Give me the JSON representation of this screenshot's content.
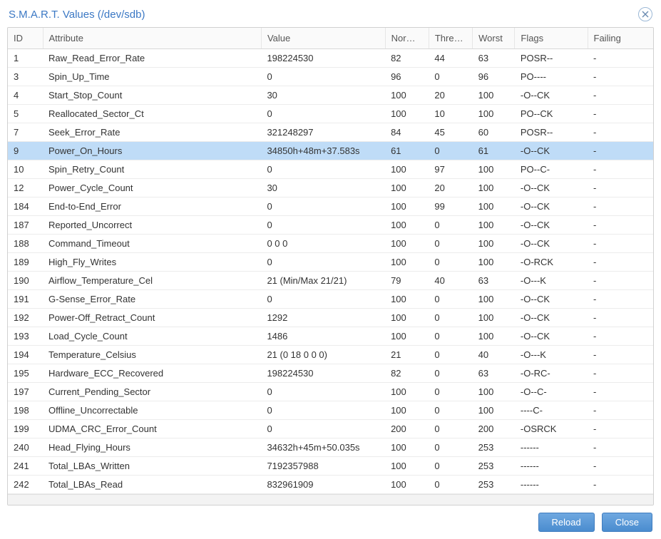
{
  "window": {
    "title": "S.M.A.R.T. Values (/dev/sdb)"
  },
  "buttons": {
    "reload": "Reload",
    "close": "Close"
  },
  "columns": {
    "id": "ID",
    "attribute": "Attribute",
    "value": "Value",
    "normalized": "Nor…",
    "threshold": "Thre…",
    "worst": "Worst",
    "flags": "Flags",
    "failing": "Failing"
  },
  "selected_row_index": 5,
  "rows": [
    {
      "id": "1",
      "attribute": "Raw_Read_Error_Rate",
      "value": "198224530",
      "nor": "82",
      "thr": "44",
      "worst": "63",
      "flags": "POSR--",
      "failing": "-"
    },
    {
      "id": "3",
      "attribute": "Spin_Up_Time",
      "value": "0",
      "nor": "96",
      "thr": "0",
      "worst": "96",
      "flags": "PO----",
      "failing": "-"
    },
    {
      "id": "4",
      "attribute": "Start_Stop_Count",
      "value": "30",
      "nor": "100",
      "thr": "20",
      "worst": "100",
      "flags": "-O--CK",
      "failing": "-"
    },
    {
      "id": "5",
      "attribute": "Reallocated_Sector_Ct",
      "value": "0",
      "nor": "100",
      "thr": "10",
      "worst": "100",
      "flags": "PO--CK",
      "failing": "-"
    },
    {
      "id": "7",
      "attribute": "Seek_Error_Rate",
      "value": "321248297",
      "nor": "84",
      "thr": "45",
      "worst": "60",
      "flags": "POSR--",
      "failing": "-"
    },
    {
      "id": "9",
      "attribute": "Power_On_Hours",
      "value": "34850h+48m+37.583s",
      "nor": "61",
      "thr": "0",
      "worst": "61",
      "flags": "-O--CK",
      "failing": "-"
    },
    {
      "id": "10",
      "attribute": "Spin_Retry_Count",
      "value": "0",
      "nor": "100",
      "thr": "97",
      "worst": "100",
      "flags": "PO--C-",
      "failing": "-"
    },
    {
      "id": "12",
      "attribute": "Power_Cycle_Count",
      "value": "30",
      "nor": "100",
      "thr": "20",
      "worst": "100",
      "flags": "-O--CK",
      "failing": "-"
    },
    {
      "id": "184",
      "attribute": "End-to-End_Error",
      "value": "0",
      "nor": "100",
      "thr": "99",
      "worst": "100",
      "flags": "-O--CK",
      "failing": "-"
    },
    {
      "id": "187",
      "attribute": "Reported_Uncorrect",
      "value": "0",
      "nor": "100",
      "thr": "0",
      "worst": "100",
      "flags": "-O--CK",
      "failing": "-"
    },
    {
      "id": "188",
      "attribute": "Command_Timeout",
      "value": "0 0 0",
      "nor": "100",
      "thr": "0",
      "worst": "100",
      "flags": "-O--CK",
      "failing": "-"
    },
    {
      "id": "189",
      "attribute": "High_Fly_Writes",
      "value": "0",
      "nor": "100",
      "thr": "0",
      "worst": "100",
      "flags": "-O-RCK",
      "failing": "-"
    },
    {
      "id": "190",
      "attribute": "Airflow_Temperature_Cel",
      "value": "21 (Min/Max 21/21)",
      "nor": "79",
      "thr": "40",
      "worst": "63",
      "flags": "-O---K",
      "failing": "-"
    },
    {
      "id": "191",
      "attribute": "G-Sense_Error_Rate",
      "value": "0",
      "nor": "100",
      "thr": "0",
      "worst": "100",
      "flags": "-O--CK",
      "failing": "-"
    },
    {
      "id": "192",
      "attribute": "Power-Off_Retract_Count",
      "value": "1292",
      "nor": "100",
      "thr": "0",
      "worst": "100",
      "flags": "-O--CK",
      "failing": "-"
    },
    {
      "id": "193",
      "attribute": "Load_Cycle_Count",
      "value": "1486",
      "nor": "100",
      "thr": "0",
      "worst": "100",
      "flags": "-O--CK",
      "failing": "-"
    },
    {
      "id": "194",
      "attribute": "Temperature_Celsius",
      "value": "21 (0 18 0 0 0)",
      "nor": "21",
      "thr": "0",
      "worst": "40",
      "flags": "-O---K",
      "failing": "-"
    },
    {
      "id": "195",
      "attribute": "Hardware_ECC_Recovered",
      "value": "198224530",
      "nor": "82",
      "thr": "0",
      "worst": "63",
      "flags": "-O-RC-",
      "failing": "-"
    },
    {
      "id": "197",
      "attribute": "Current_Pending_Sector",
      "value": "0",
      "nor": "100",
      "thr": "0",
      "worst": "100",
      "flags": "-O--C-",
      "failing": "-"
    },
    {
      "id": "198",
      "attribute": "Offline_Uncorrectable",
      "value": "0",
      "nor": "100",
      "thr": "0",
      "worst": "100",
      "flags": "----C-",
      "failing": "-"
    },
    {
      "id": "199",
      "attribute": "UDMA_CRC_Error_Count",
      "value": "0",
      "nor": "200",
      "thr": "0",
      "worst": "200",
      "flags": "-OSRCK",
      "failing": "-"
    },
    {
      "id": "240",
      "attribute": "Head_Flying_Hours",
      "value": "34632h+45m+50.035s",
      "nor": "100",
      "thr": "0",
      "worst": "253",
      "flags": "------",
      "failing": "-"
    },
    {
      "id": "241",
      "attribute": "Total_LBAs_Written",
      "value": "7192357988",
      "nor": "100",
      "thr": "0",
      "worst": "253",
      "flags": "------",
      "failing": "-"
    },
    {
      "id": "242",
      "attribute": "Total_LBAs_Read",
      "value": "832961909",
      "nor": "100",
      "thr": "0",
      "worst": "253",
      "flags": "------",
      "failing": "-"
    }
  ]
}
